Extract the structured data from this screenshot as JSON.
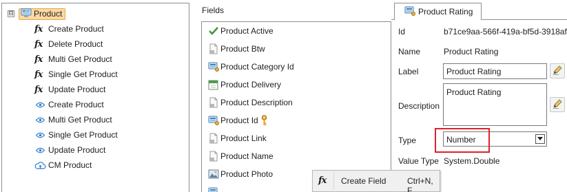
{
  "tree": {
    "root": {
      "label": "Product",
      "expander": "⊟",
      "icon": "entity-icon"
    },
    "items": [
      {
        "kind": "fx",
        "label": "Create Product"
      },
      {
        "kind": "fx",
        "label": "Delete Product"
      },
      {
        "kind": "fx",
        "label": "Multi Get Product"
      },
      {
        "kind": "fx",
        "label": "Single Get Product"
      },
      {
        "kind": "fx",
        "label": "Update Product"
      },
      {
        "kind": "view",
        "label": "Create Product"
      },
      {
        "kind": "view",
        "label": "Multi Get Product"
      },
      {
        "kind": "view",
        "label": "Single Get Product"
      },
      {
        "kind": "view",
        "label": "Update Product"
      },
      {
        "kind": "cloud",
        "label": "CM Product"
      }
    ]
  },
  "fields": {
    "title": "Fields",
    "items": [
      {
        "label": "Product Active",
        "icon": "checkmark-icon",
        "key": false
      },
      {
        "label": "Product Btw",
        "icon": "document-icon",
        "key": false
      },
      {
        "label": "Product Category Id",
        "icon": "entity-ref-icon",
        "key": false
      },
      {
        "label": "Product Delivery",
        "icon": "calendar-icon",
        "key": false
      },
      {
        "label": "Product Description",
        "icon": "document-icon",
        "key": false
      },
      {
        "label": "Product Id",
        "icon": "entity-ref-icon",
        "key": true
      },
      {
        "label": "Product Link",
        "icon": "document-icon",
        "key": false
      },
      {
        "label": "Product Name",
        "icon": "document-icon",
        "key": false
      },
      {
        "label": "Product Photo",
        "icon": "image-icon",
        "key": false
      }
    ]
  },
  "context_menu": {
    "label": "Create Field",
    "shortcut": "Ctrl+N, F",
    "icon": "fx-icon"
  },
  "properties": {
    "tab_label": "Product Rating",
    "id_label": "Id",
    "id_value": "b71ce9aa-566f-419a-bf5d-3918af",
    "name_label": "Name",
    "name_value": "Product Rating",
    "label_label": "Label",
    "label_value": "Product Rating",
    "description_label": "Description",
    "description_value": "Product Rating",
    "type_label": "Type",
    "type_value": "Number",
    "value_type_label": "Value Type",
    "value_type_value": "System.Double"
  },
  "colors": {
    "highlight": "#e0202a",
    "root_chip": "#fbd9a3",
    "check_green": "#3c9a3c"
  }
}
